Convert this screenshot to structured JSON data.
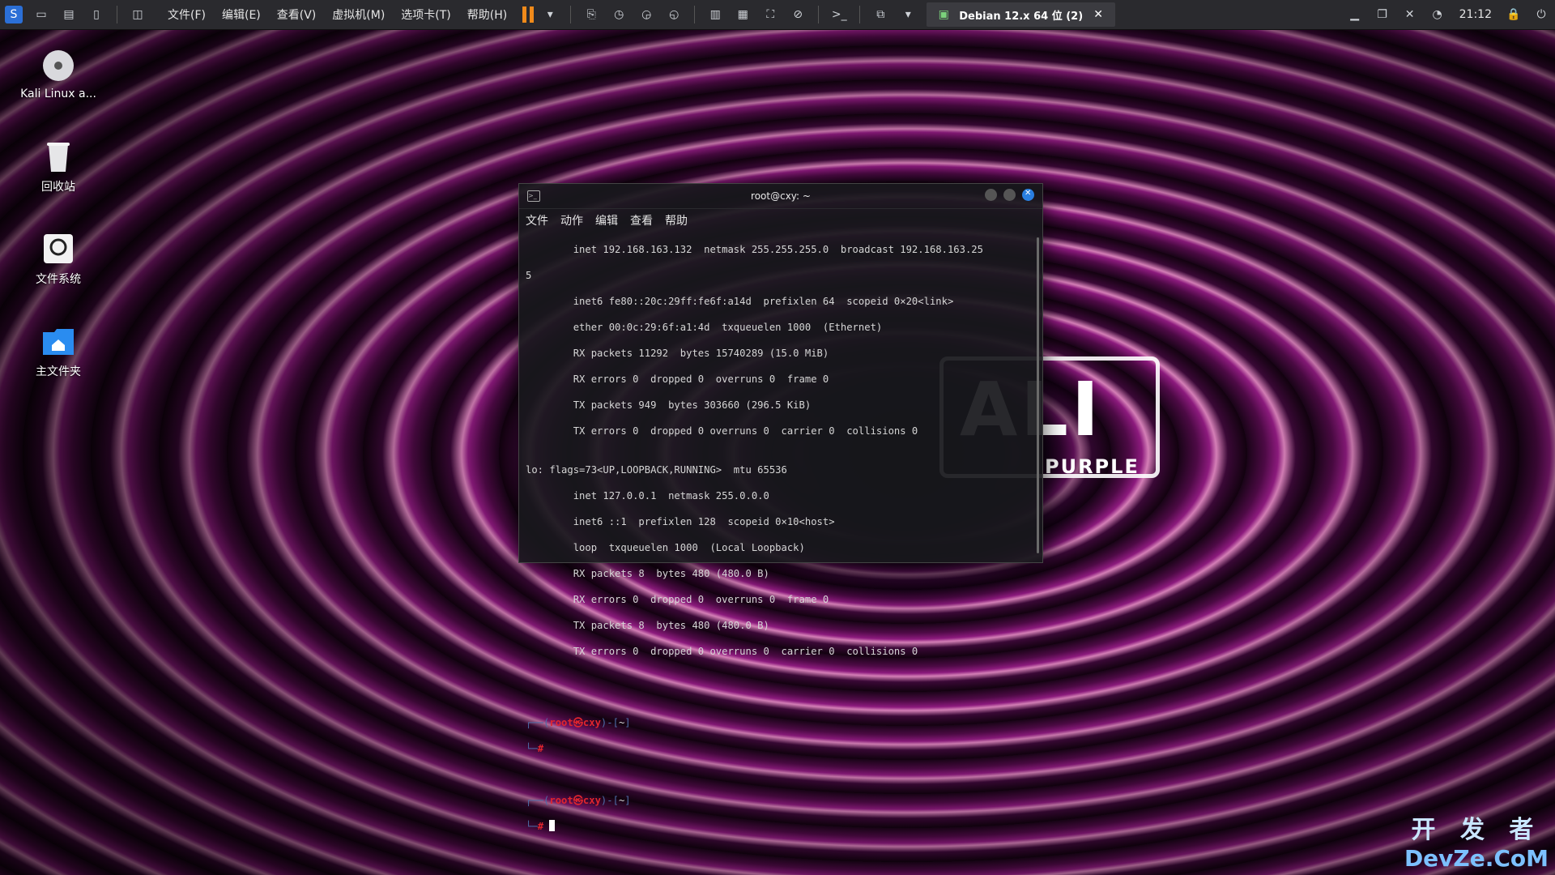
{
  "topbar": {
    "menu": [
      "文件(F)",
      "编辑(E)",
      "查看(V)",
      "虚拟机(M)",
      "选项卡(T)",
      "帮助(H)"
    ],
    "vm_tab_label": "Debian 12.x 64 位 (2)",
    "clock": "21:12",
    "accent_color": "#f08a1a"
  },
  "desktop": {
    "icons": [
      {
        "label": "Kali Linux a...",
        "icon": "disc-icon"
      },
      {
        "label": "回收站",
        "icon": "trash-icon"
      },
      {
        "label": "文件系统",
        "icon": "drive-icon"
      },
      {
        "label": "主文件夹",
        "icon": "home-folder-icon"
      }
    ],
    "wallpaper": {
      "brand_text": "ALI",
      "sub_text": "PURPLE"
    }
  },
  "terminal": {
    "title": "root@cxy: ~",
    "menu": [
      "文件",
      "动作",
      "编辑",
      "查看",
      "帮助"
    ],
    "lines": [
      "        inet 192.168.163.132  netmask 255.255.255.0  broadcast 192.168.163.25",
      "5",
      "        inet6 fe80::20c:29ff:fe6f:a14d  prefixlen 64  scopeid 0×20<link>",
      "        ether 00:0c:29:6f:a1:4d  txqueuelen 1000  (Ethernet)",
      "        RX packets 11292  bytes 15740289 (15.0 MiB)",
      "        RX errors 0  dropped 0  overruns 0  frame 0",
      "        TX packets 949  bytes 303660 (296.5 KiB)",
      "        TX errors 0  dropped 0 overruns 0  carrier 0  collisions 0",
      "",
      "lo: flags=73<UP,LOOPBACK,RUNNING>  mtu 65536",
      "        inet 127.0.0.1  netmask 255.0.0.0",
      "        inet6 ::1  prefixlen 128  scopeid 0×10<host>",
      "        loop  txqueuelen 1000  (Local Loopback)",
      "        RX packets 8  bytes 480 (480.0 B)",
      "        RX errors 0  dropped 0  overruns 0  frame 0",
      "        TX packets 8  bytes 480 (480.0 B)",
      "        TX errors 0  dropped 0 overruns 0  carrier 0  collisions 0"
    ],
    "prompt_user": "root㉿cxy",
    "prompt_dir": "~",
    "prompt_symbol": "#"
  },
  "watermark": {
    "line1": "开 发 者",
    "line2": "DevZe.CoM"
  }
}
